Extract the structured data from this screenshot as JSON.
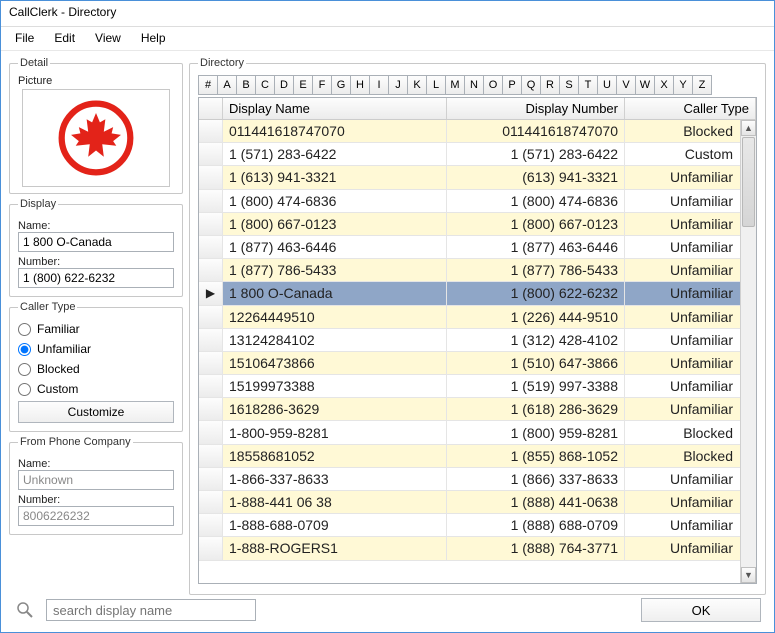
{
  "window_title": "CallClerk - Directory",
  "menu": [
    "File",
    "Edit",
    "View",
    "Help"
  ],
  "detail": {
    "group_label": "Detail",
    "picture_label": "Picture",
    "display_group": "Display",
    "name_label": "Name:",
    "name_value": "1 800 O-Canada",
    "number_label": "Number:",
    "number_value": "1 (800) 622-6232",
    "callertype_group": "Caller Type",
    "radios": [
      "Familiar",
      "Unfamiliar",
      "Blocked",
      "Custom"
    ],
    "radio_selected_index": 1,
    "customize_label": "Customize",
    "fromco_group": "From Phone Company",
    "fromco_name_label": "Name:",
    "fromco_name_value": "Unknown",
    "fromco_number_label": "Number:",
    "fromco_number_value": "8006226232"
  },
  "directory": {
    "group_label": "Directory",
    "az": [
      "#",
      "A",
      "B",
      "C",
      "D",
      "E",
      "F",
      "G",
      "H",
      "I",
      "J",
      "K",
      "L",
      "M",
      "N",
      "O",
      "P",
      "Q",
      "R",
      "S",
      "T",
      "U",
      "V",
      "W",
      "X",
      "Y",
      "Z"
    ],
    "columns": {
      "display_name": "Display Name",
      "display_number": "Display Number",
      "caller_type": "Caller Type"
    },
    "selected_index": 7,
    "rows": [
      {
        "name": "011441618747070",
        "number": "011441618747070",
        "type": "Blocked"
      },
      {
        "name": "1 (571) 283-6422",
        "number": "1 (571) 283-6422",
        "type": "Custom"
      },
      {
        "name": "1 (613) 941-3321",
        "number": "(613) 941-3321",
        "type": "Unfamiliar"
      },
      {
        "name": "1 (800) 474-6836",
        "number": "1 (800) 474-6836",
        "type": "Unfamiliar"
      },
      {
        "name": "1 (800) 667-0123",
        "number": "1 (800) 667-0123",
        "type": "Unfamiliar"
      },
      {
        "name": "1 (877) 463-6446",
        "number": "1 (877) 463-6446",
        "type": "Unfamiliar"
      },
      {
        "name": "1 (877) 786-5433",
        "number": "1 (877) 786-5433",
        "type": "Unfamiliar"
      },
      {
        "name": "1 800 O-Canada",
        "number": "1 (800) 622-6232",
        "type": "Unfamiliar"
      },
      {
        "name": "12264449510",
        "number": "1 (226) 444-9510",
        "type": "Unfamiliar"
      },
      {
        "name": "13124284102",
        "number": "1 (312) 428-4102",
        "type": "Unfamiliar"
      },
      {
        "name": "15106473866",
        "number": "1 (510) 647-3866",
        "type": "Unfamiliar"
      },
      {
        "name": "15199973388",
        "number": "1 (519) 997-3388",
        "type": "Unfamiliar"
      },
      {
        "name": "1618286-3629",
        "number": "1 (618) 286-3629",
        "type": "Unfamiliar"
      },
      {
        "name": "1-800-959-8281",
        "number": "1 (800) 959-8281",
        "type": "Blocked"
      },
      {
        "name": "18558681052",
        "number": "1 (855) 868-1052",
        "type": "Blocked"
      },
      {
        "name": "1-866-337-8633",
        "number": "1 (866) 337-8633",
        "type": "Unfamiliar"
      },
      {
        "name": "1-888-441 06 38",
        "number": "1 (888) 441-0638",
        "type": "Unfamiliar"
      },
      {
        "name": "1-888-688-0709",
        "number": "1 (888) 688-0709",
        "type": "Unfamiliar"
      },
      {
        "name": "1-888-ROGERS1",
        "number": "1 (888) 764-3771",
        "type": "Unfamiliar"
      }
    ]
  },
  "search_placeholder": "search display name",
  "ok_label": "OK"
}
